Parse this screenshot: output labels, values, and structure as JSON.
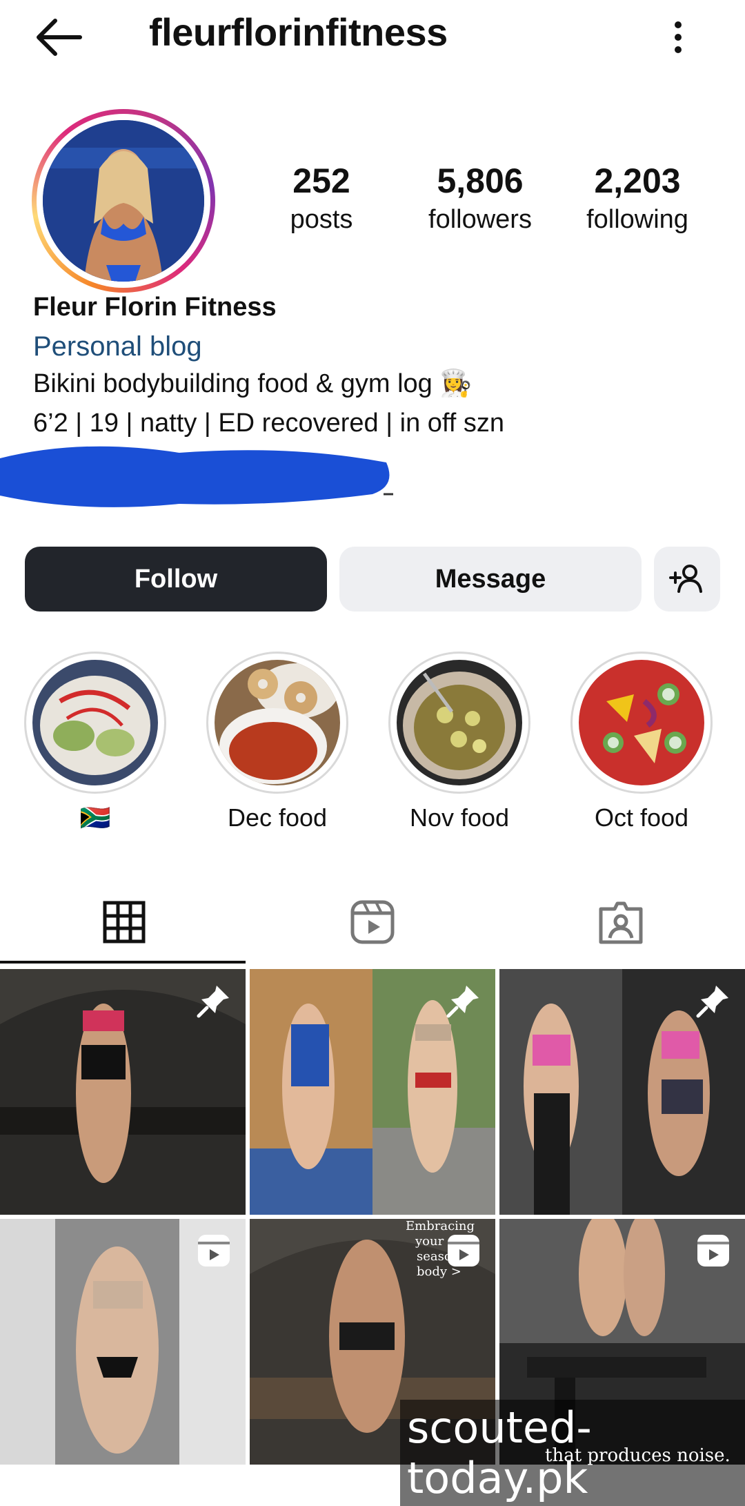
{
  "header": {
    "username": "fleurflorinfitness",
    "back_icon": "arrow-left-icon",
    "more_icon": "more-vertical-icon"
  },
  "profile": {
    "stats": [
      {
        "value": "252",
        "label": "posts"
      },
      {
        "value": "5,806",
        "label": "followers"
      },
      {
        "value": "2,203",
        "label": "following"
      }
    ],
    "name": "Fleur Florin Fitness",
    "category": "Personal blog",
    "bio_line1": "Bikini bodybuilding food & gym log 👩‍🍳",
    "bio_line2": "6’2 | 19 | natty | ED recovered | in off szn",
    "story_ring_colors": [
      "#f58529",
      "#dd2a7b",
      "#8134af"
    ]
  },
  "actions": {
    "follow": "Follow",
    "message": "Message",
    "add_user_icon": "person-add-icon"
  },
  "highlights": [
    {
      "label": "🇿🇦"
    },
    {
      "label": "Dec food"
    },
    {
      "label": "Nov food"
    },
    {
      "label": "Oct food"
    }
  ],
  "tabs": [
    {
      "icon": "grid-icon",
      "active": true
    },
    {
      "icon": "reels-icon",
      "active": false
    },
    {
      "icon": "tagged-icon",
      "active": false
    }
  ],
  "posts": [
    {
      "type": "pinned",
      "overlay_text": ""
    },
    {
      "type": "pinned",
      "overlay_text": ""
    },
    {
      "type": "pinned",
      "overlay_text": ""
    },
    {
      "type": "reel",
      "overlay_text": ""
    },
    {
      "type": "reel",
      "overlay_text": "Embracing your o season body >"
    },
    {
      "type": "reel",
      "overlay_text": ""
    }
  ],
  "watermark": {
    "text": "scouted-today.pk",
    "bottom_caption": "that produces noise."
  },
  "colors": {
    "follow_bg": "#22252b",
    "secondary_bg": "#eeeff2",
    "category_text": "#1f4e79",
    "redaction": "#1a4fd6"
  }
}
